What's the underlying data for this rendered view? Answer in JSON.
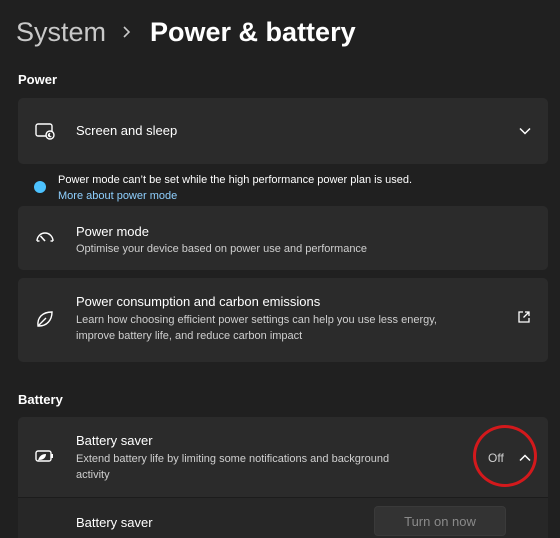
{
  "breadcrumb": {
    "parent": "System",
    "current": "Power & battery"
  },
  "power_section": {
    "title": "Power",
    "screen_sleep": {
      "title": "Screen and sleep",
      "icon": "screen-sleep-icon"
    },
    "notice": {
      "text": "Power mode can’t be set while the high performance power plan is used.",
      "link": "More about power mode",
      "icon": "info-icon",
      "color": "#4cc2ff"
    },
    "power_mode": {
      "title": "Power mode",
      "description": "Optimise your device based on power use and performance",
      "icon": "gauge-icon"
    },
    "consumption": {
      "title": "Power consumption and carbon emissions",
      "description_line1": "Learn how choosing efficient power settings can help you use less energy,",
      "description_line2": "improve battery life, and reduce carbon impact",
      "icon": "leaf-icon",
      "action_icon": "open-external-icon"
    }
  },
  "battery_section": {
    "title": "Battery",
    "saver": {
      "title": "Battery saver",
      "description_line1": "Extend battery life by limiting some notifications and background",
      "description_line2": "activity",
      "state": "Off",
      "icon": "battery-saver-icon",
      "highlight_color": "#d3191c"
    },
    "saver_row": {
      "label": "Battery saver",
      "button": "Turn on now"
    }
  }
}
